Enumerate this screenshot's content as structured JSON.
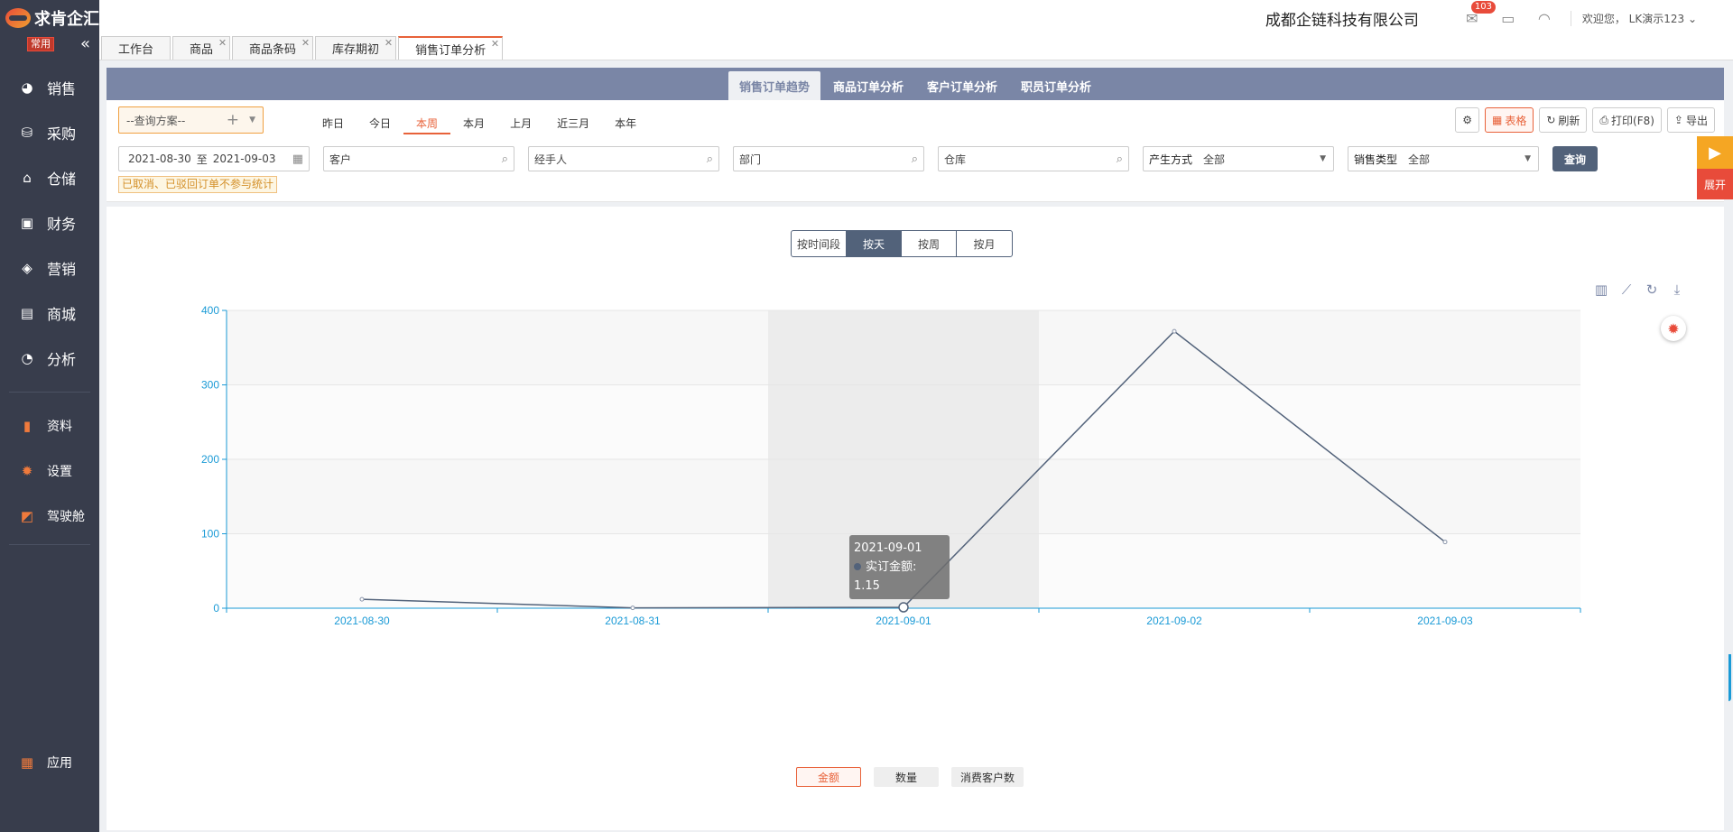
{
  "logo": {
    "text": "%E6%B1%82%E8%82%AF%E4%BC%81%E6%B1%87"
  },
  "sidebar": {
    "tag": "常用",
    "items": [
      {
        "label": "销售",
        "icon": "sales-icon"
      },
      {
        "label": "采购",
        "icon": "basket-icon"
      },
      {
        "label": "仓储",
        "icon": "warehouse-icon"
      },
      {
        "label": "财务",
        "icon": "wallet-icon"
      },
      {
        "label": "营销",
        "icon": "tag-icon"
      },
      {
        "label": "商城",
        "icon": "store-icon"
      },
      {
        "label": "分析",
        "icon": "pie-icon"
      }
    ],
    "secondary": [
      {
        "label": "资料",
        "icon": "doc-icon"
      },
      {
        "label": "设置",
        "icon": "gear-icon"
      },
      {
        "label": "驾驶舱",
        "icon": "chart-icon"
      }
    ],
    "bottom": {
      "label": "应用",
      "icon": "apps-icon"
    }
  },
  "topbar": {
    "company": "成都企链科技有限公司",
    "badge": "103",
    "welcome": "欢迎您，  LK演示123"
  },
  "tabs": [
    {
      "label": "工作台",
      "closable": false
    },
    {
      "label": "商品",
      "closable": true
    },
    {
      "label": "商品条码",
      "closable": true
    },
    {
      "label": "库存期初",
      "closable": true
    },
    {
      "label": "销售订单分析",
      "closable": true,
      "active": true
    }
  ],
  "subnav": [
    "销售订单趋势",
    "商品订单分析",
    "客户订单分析",
    "职员订单分析"
  ],
  "filters": {
    "scheme": "--查询方案--",
    "quick": [
      "昨日",
      "今日",
      "本周",
      "本月",
      "上月",
      "近三月",
      "本年"
    ],
    "quick_active": "本周",
    "tools": {
      "table": "表格",
      "refresh": "刷新",
      "print": "打印(F8)",
      "export": "导出"
    },
    "date_from": "2021-08-30",
    "date_sep": "至",
    "date_to": "2021-09-03",
    "customer": "客户",
    "handler": "经手人",
    "dept": "部门",
    "warehouse": "仓库",
    "source_label": "产生方式",
    "source_value": "全部",
    "saletype_label": "销售类型",
    "saletype_value": "全部",
    "query": "查询",
    "note": "已取消、已驳回订单不参与统计"
  },
  "segments": [
    "按时间段",
    "按天",
    "按周",
    "按月"
  ],
  "segment_active": "按天",
  "legend": [
    "金额",
    "数量",
    "消费客户数"
  ],
  "legend_active": "金额",
  "tooltip": {
    "title": "2021-09-01",
    "label": "实订金额",
    "value": "1.15"
  },
  "right_fab": {
    "label": "展开"
  },
  "chart_data": {
    "type": "line",
    "categories": [
      "2021-08-30",
      "2021-08-31",
      "2021-09-01",
      "2021-09-02",
      "2021-09-03"
    ],
    "series": [
      {
        "name": "实订金额",
        "values": [
          12,
          0.5,
          1.15,
          372,
          89
        ]
      }
    ],
    "ylim": [
      0,
      400
    ],
    "yticks": [
      0,
      100,
      200,
      300,
      400
    ],
    "highlight_category": "2021-09-01",
    "colors": {
      "line": "#52627a",
      "axis": "#1a9ad6",
      "band_a": "#f7f7f7",
      "band_b": "#fbfbfb",
      "highlight": "#ececec"
    }
  }
}
